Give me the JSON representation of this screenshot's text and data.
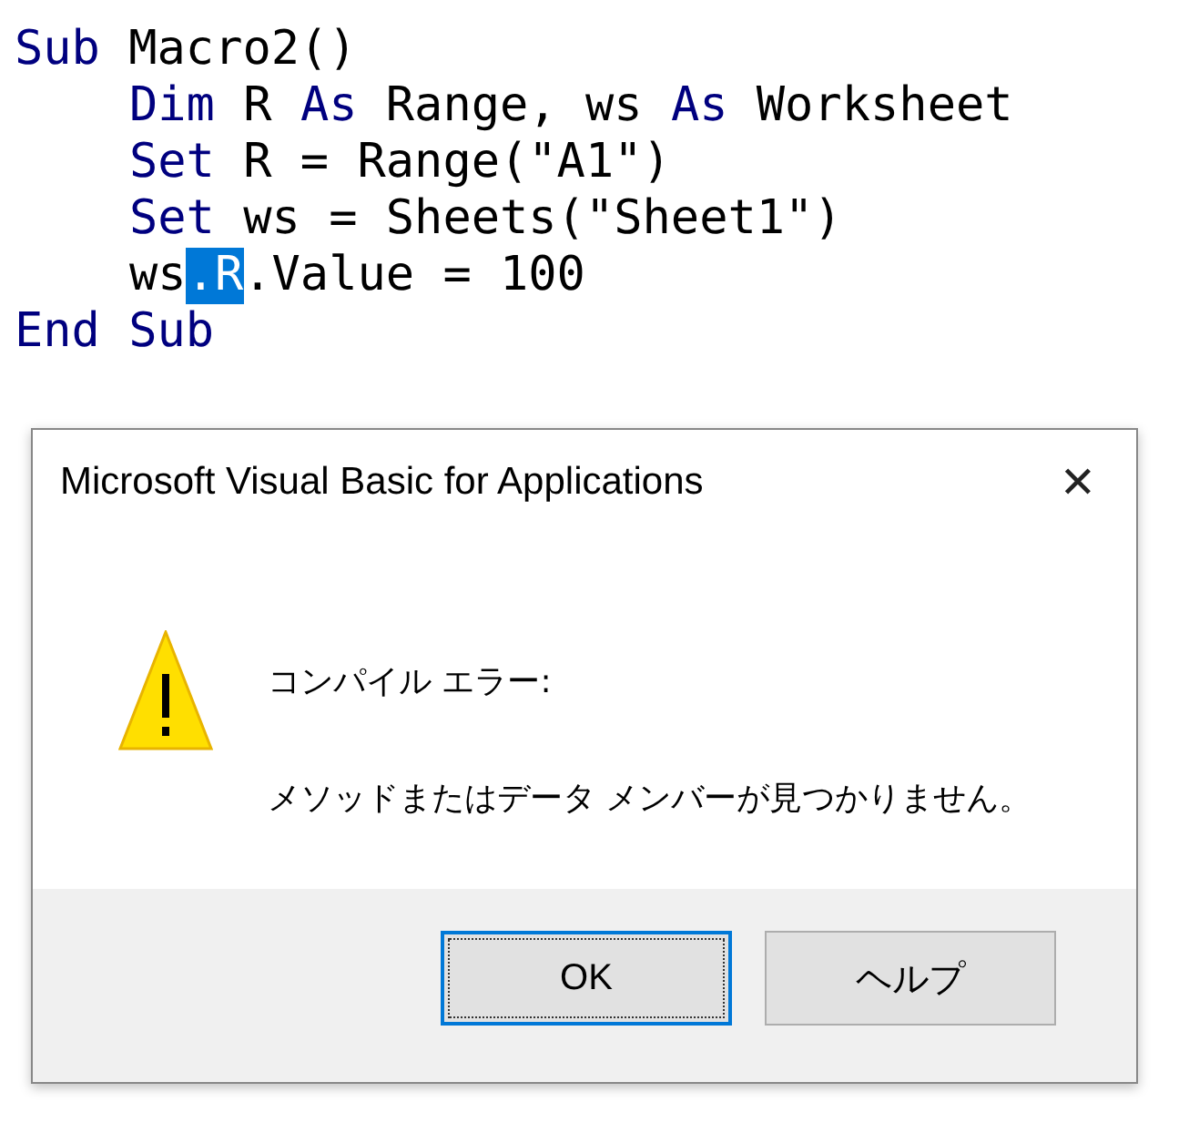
{
  "code_editor": {
    "lines": [
      {
        "indented": false,
        "tokens": [
          {
            "text": "Sub",
            "kind": "keyword"
          },
          {
            "text": " Macro2()",
            "kind": "plain"
          }
        ]
      },
      {
        "indented": true,
        "tokens": [
          {
            "text": "Dim",
            "kind": "keyword"
          },
          {
            "text": " R ",
            "kind": "plain"
          },
          {
            "text": "As",
            "kind": "keyword"
          },
          {
            "text": " Range, ws ",
            "kind": "plain"
          },
          {
            "text": "As",
            "kind": "keyword"
          },
          {
            "text": " Worksheet",
            "kind": "plain"
          }
        ]
      },
      {
        "indented": true,
        "tokens": [
          {
            "text": "Set",
            "kind": "keyword"
          },
          {
            "text": " R = Range(\"A1\")",
            "kind": "plain"
          }
        ]
      },
      {
        "indented": true,
        "tokens": [
          {
            "text": "Set",
            "kind": "keyword"
          },
          {
            "text": " ws = Sheets(\"Sheet1\")",
            "kind": "plain"
          }
        ]
      },
      {
        "indented": true,
        "tokens": [
          {
            "text": "ws",
            "kind": "plain"
          },
          {
            "text": ".R",
            "kind": "selected"
          },
          {
            "text": ".Value = 100",
            "kind": "plain"
          }
        ]
      },
      {
        "indented": false,
        "tokens": [
          {
            "text": "End Sub",
            "kind": "keyword"
          }
        ]
      }
    ]
  },
  "dialog": {
    "title": "Microsoft Visual Basic for Applications",
    "close": "✕",
    "heading": "コンパイル エラー:",
    "message": "メソッドまたはデータ メンバーが見つかりません。",
    "buttons": [
      {
        "label": "OK",
        "default": true
      },
      {
        "label": "ヘルプ",
        "default": false
      }
    ]
  }
}
